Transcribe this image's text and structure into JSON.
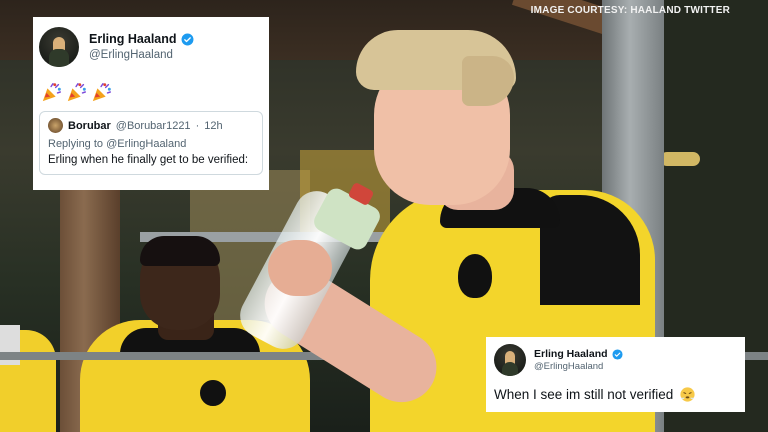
{
  "watermark": {
    "credit": "IMAGE COURTESY: HAALAND TWITTER"
  },
  "photo": {
    "description_icon": "football-players-photo"
  },
  "tweet_top": {
    "display_name": "Erling Haaland",
    "handle": "@ErlingHaaland",
    "verified": true,
    "emojis": [
      "party-popper",
      "party-popper",
      "party-popper"
    ],
    "quoted": {
      "display_name": "Borubar",
      "handle": "@Borubar1221",
      "separator": "·",
      "time": "12h",
      "replying_to": "Replying to @ErlingHaaland",
      "text": "Erling when he finally get to be verified:"
    }
  },
  "tweet_bottom": {
    "display_name": "Erling Haaland",
    "handle": "@ErlingHaaland",
    "verified": true,
    "text": "When I see im still not verified",
    "emoji": "face-with-steam-from-nose"
  },
  "colors": {
    "verified_blue": "#1d9bf0",
    "jersey_yellow": "#f3d52b",
    "text_secondary": "#536471"
  }
}
